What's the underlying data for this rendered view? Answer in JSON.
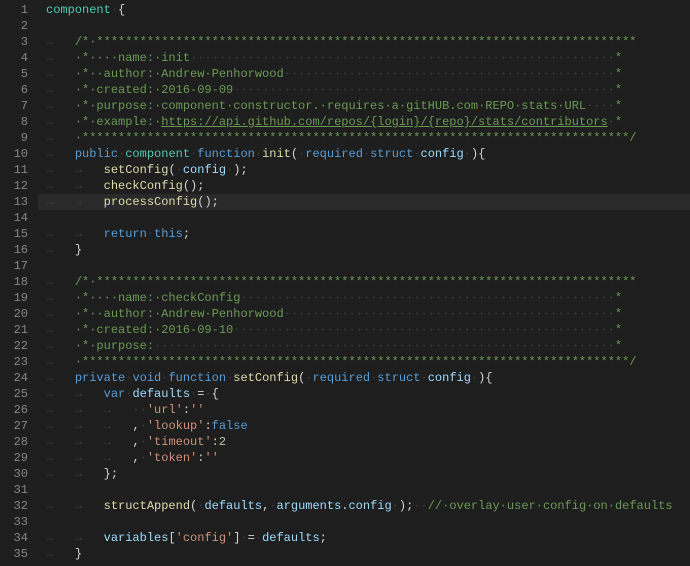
{
  "lines": [
    {
      "n": 1,
      "indent": 0,
      "fold": false,
      "tokens": [
        [
          "type",
          "component"
        ],
        [
          "ws",
          "·"
        ],
        [
          "punc",
          "{"
        ]
      ]
    },
    {
      "n": 2,
      "indent": 0,
      "fold": false,
      "tokens": []
    },
    {
      "n": 3,
      "indent": 1,
      "fold": false,
      "tokens": [
        [
          "cmt",
          "/*·***************************************************************************"
        ]
      ]
    },
    {
      "n": 4,
      "indent": 1,
      "fold": false,
      "tokens": [
        [
          "cmt",
          "·*····name:·init"
        ],
        [
          "ws",
          "···························································"
        ],
        [
          "cmt",
          "*"
        ]
      ]
    },
    {
      "n": 5,
      "indent": 1,
      "fold": false,
      "tokens": [
        [
          "cmt",
          "·*··author:·Andrew·Penhorwood"
        ],
        [
          "ws",
          "··············································"
        ],
        [
          "cmt",
          "*"
        ]
      ]
    },
    {
      "n": 6,
      "indent": 1,
      "fold": false,
      "tokens": [
        [
          "cmt",
          "·*·created:·2016-09-09"
        ],
        [
          "ws",
          "·····················································"
        ],
        [
          "cmt",
          "*"
        ]
      ]
    },
    {
      "n": 7,
      "indent": 1,
      "fold": false,
      "tokens": [
        [
          "cmt",
          "·*·purpose:·component·constructor.·requires·a·gitHUB.com·REPO·stats·URL"
        ],
        [
          "ws",
          "····"
        ],
        [
          "cmt",
          "*"
        ]
      ]
    },
    {
      "n": 8,
      "indent": 1,
      "fold": false,
      "tokens": [
        [
          "cmt",
          "·*·example:·"
        ],
        [
          "cmtU",
          "https://api.github.com/repos/{login}/{repo}/stats/contributors"
        ],
        [
          "ws",
          "·"
        ],
        [
          "cmt",
          "*"
        ]
      ]
    },
    {
      "n": 9,
      "indent": 1,
      "fold": false,
      "tokens": [
        [
          "cmt",
          "·****************************************************************************/"
        ]
      ]
    },
    {
      "n": 10,
      "indent": 1,
      "fold": true,
      "tokens": [
        [
          "kw",
          "public"
        ],
        [
          "ws",
          "·"
        ],
        [
          "type",
          "component"
        ],
        [
          "ws",
          "·"
        ],
        [
          "kw",
          "function"
        ],
        [
          "ws",
          "·"
        ],
        [
          "fn",
          "init"
        ],
        [
          "punc",
          "("
        ],
        [
          "ws",
          "·"
        ],
        [
          "kw",
          "required"
        ],
        [
          "ws",
          "·"
        ],
        [
          "kw",
          "struct"
        ],
        [
          "ws",
          "·"
        ],
        [
          "id",
          "config"
        ],
        [
          "ws",
          "·"
        ],
        [
          "punc",
          ")"
        ],
        [
          "punc",
          "{"
        ]
      ]
    },
    {
      "n": 11,
      "indent": 2,
      "fold": false,
      "tokens": [
        [
          "fn",
          "setConfig"
        ],
        [
          "punc",
          "("
        ],
        [
          "ws",
          "·"
        ],
        [
          "id",
          "config"
        ],
        [
          "ws",
          "·"
        ],
        [
          "punc",
          ")"
        ],
        [
          "punc",
          ";"
        ]
      ]
    },
    {
      "n": 12,
      "indent": 2,
      "fold": false,
      "tokens": [
        [
          "fn",
          "checkConfig"
        ],
        [
          "punc",
          "("
        ],
        [
          "punc",
          ")"
        ],
        [
          "punc",
          ";"
        ]
      ]
    },
    {
      "n": 13,
      "indent": 2,
      "fold": false,
      "hl": true,
      "tokens": [
        [
          "fn",
          "processConfig"
        ],
        [
          "punc",
          "("
        ],
        [
          "punc",
          ")"
        ],
        [
          "punc",
          ";"
        ]
      ]
    },
    {
      "n": 14,
      "indent": 0,
      "fold": false,
      "tokens": []
    },
    {
      "n": 15,
      "indent": 2,
      "fold": false,
      "tokens": [
        [
          "kw",
          "return"
        ],
        [
          "ws",
          "·"
        ],
        [
          "this",
          "this"
        ],
        [
          "punc",
          ";"
        ]
      ]
    },
    {
      "n": 16,
      "indent": 1,
      "fold": false,
      "tokens": [
        [
          "punc",
          "}"
        ]
      ]
    },
    {
      "n": 17,
      "indent": 0,
      "fold": false,
      "tokens": []
    },
    {
      "n": 18,
      "indent": 1,
      "fold": false,
      "tokens": [
        [
          "cmt",
          "/*·***************************************************************************"
        ]
      ]
    },
    {
      "n": 19,
      "indent": 1,
      "fold": false,
      "tokens": [
        [
          "cmt",
          "·*····name:·checkConfig"
        ],
        [
          "ws",
          "····················································"
        ],
        [
          "cmt",
          "*"
        ]
      ]
    },
    {
      "n": 20,
      "indent": 1,
      "fold": false,
      "tokens": [
        [
          "cmt",
          "·*··author:·Andrew·Penhorwood"
        ],
        [
          "ws",
          "··············································"
        ],
        [
          "cmt",
          "*"
        ]
      ]
    },
    {
      "n": 21,
      "indent": 1,
      "fold": false,
      "tokens": [
        [
          "cmt",
          "·*·created:·2016-09-10"
        ],
        [
          "ws",
          "·····················································"
        ],
        [
          "cmt",
          "*"
        ]
      ]
    },
    {
      "n": 22,
      "indent": 1,
      "fold": false,
      "tokens": [
        [
          "cmt",
          "·*·purpose:"
        ],
        [
          "ws",
          "································································"
        ],
        [
          "cmt",
          "*"
        ]
      ]
    },
    {
      "n": 23,
      "indent": 1,
      "fold": false,
      "tokens": [
        [
          "cmt",
          "·****************************************************************************/"
        ]
      ]
    },
    {
      "n": 24,
      "indent": 1,
      "fold": true,
      "tokens": [
        [
          "kw",
          "private"
        ],
        [
          "ws",
          "·"
        ],
        [
          "kw",
          "void"
        ],
        [
          "ws",
          "·"
        ],
        [
          "kw",
          "function"
        ],
        [
          "ws",
          "·"
        ],
        [
          "fn",
          "setConfig"
        ],
        [
          "punc",
          "("
        ],
        [
          "ws",
          "·"
        ],
        [
          "kw",
          "required"
        ],
        [
          "ws",
          "·"
        ],
        [
          "kw",
          "struct"
        ],
        [
          "ws",
          "·"
        ],
        [
          "id",
          "config"
        ],
        [
          "ws",
          "·"
        ],
        [
          "punc",
          ")"
        ],
        [
          "punc",
          "{"
        ]
      ]
    },
    {
      "n": 25,
      "indent": 2,
      "fold": true,
      "tokens": [
        [
          "kw",
          "var"
        ],
        [
          "ws",
          "·"
        ],
        [
          "id",
          "defaults"
        ],
        [
          "ws",
          "·"
        ],
        [
          "punc",
          "="
        ],
        [
          "ws",
          "·"
        ],
        [
          "punc",
          "{"
        ]
      ]
    },
    {
      "n": 26,
      "indent": 3,
      "fold": false,
      "tokens": [
        [
          "ws",
          "··"
        ],
        [
          "str",
          "'url'"
        ],
        [
          "punc",
          ":"
        ],
        [
          "str",
          "''"
        ]
      ]
    },
    {
      "n": 27,
      "indent": 3,
      "fold": false,
      "tokens": [
        [
          "punc",
          ","
        ],
        [
          "ws",
          "·"
        ],
        [
          "str",
          "'lookup'"
        ],
        [
          "punc",
          ":"
        ],
        [
          "bool",
          "false"
        ]
      ]
    },
    {
      "n": 28,
      "indent": 3,
      "fold": false,
      "tokens": [
        [
          "punc",
          ","
        ],
        [
          "ws",
          "·"
        ],
        [
          "str",
          "'timeout'"
        ],
        [
          "punc",
          ":"
        ],
        [
          "num",
          "2"
        ]
      ]
    },
    {
      "n": 29,
      "indent": 3,
      "fold": false,
      "tokens": [
        [
          "punc",
          ","
        ],
        [
          "ws",
          "·"
        ],
        [
          "str",
          "'token'"
        ],
        [
          "punc",
          ":"
        ],
        [
          "str",
          "''"
        ]
      ]
    },
    {
      "n": 30,
      "indent": 2,
      "fold": false,
      "tokens": [
        [
          "punc",
          "}"
        ],
        [
          "punc",
          ";"
        ]
      ]
    },
    {
      "n": 31,
      "indent": 0,
      "fold": false,
      "tokens": []
    },
    {
      "n": 32,
      "indent": 2,
      "fold": false,
      "tokens": [
        [
          "fn",
          "structAppend"
        ],
        [
          "punc",
          "("
        ],
        [
          "ws",
          "·"
        ],
        [
          "id",
          "defaults"
        ],
        [
          "punc",
          ","
        ],
        [
          "ws",
          "·"
        ],
        [
          "id",
          "arguments"
        ],
        [
          "punc",
          "."
        ],
        [
          "id",
          "config"
        ],
        [
          "ws",
          "·"
        ],
        [
          "punc",
          ")"
        ],
        [
          "punc",
          ";"
        ],
        [
          "ws",
          "··"
        ],
        [
          "cmt",
          "//·overlay·user·config·on·defaults"
        ]
      ]
    },
    {
      "n": 33,
      "indent": 0,
      "fold": false,
      "tokens": []
    },
    {
      "n": 34,
      "indent": 2,
      "fold": false,
      "tokens": [
        [
          "id",
          "variables"
        ],
        [
          "punc",
          "["
        ],
        [
          "str",
          "'config'"
        ],
        [
          "punc",
          "]"
        ],
        [
          "ws",
          "·"
        ],
        [
          "punc",
          "="
        ],
        [
          "ws",
          "·"
        ],
        [
          "id",
          "defaults"
        ],
        [
          "punc",
          ";"
        ]
      ]
    },
    {
      "n": 35,
      "indent": 1,
      "fold": false,
      "tokens": [
        [
          "punc",
          "}"
        ]
      ]
    }
  ],
  "indentGlyph": "→   ",
  "foldGlyph": "⌄"
}
